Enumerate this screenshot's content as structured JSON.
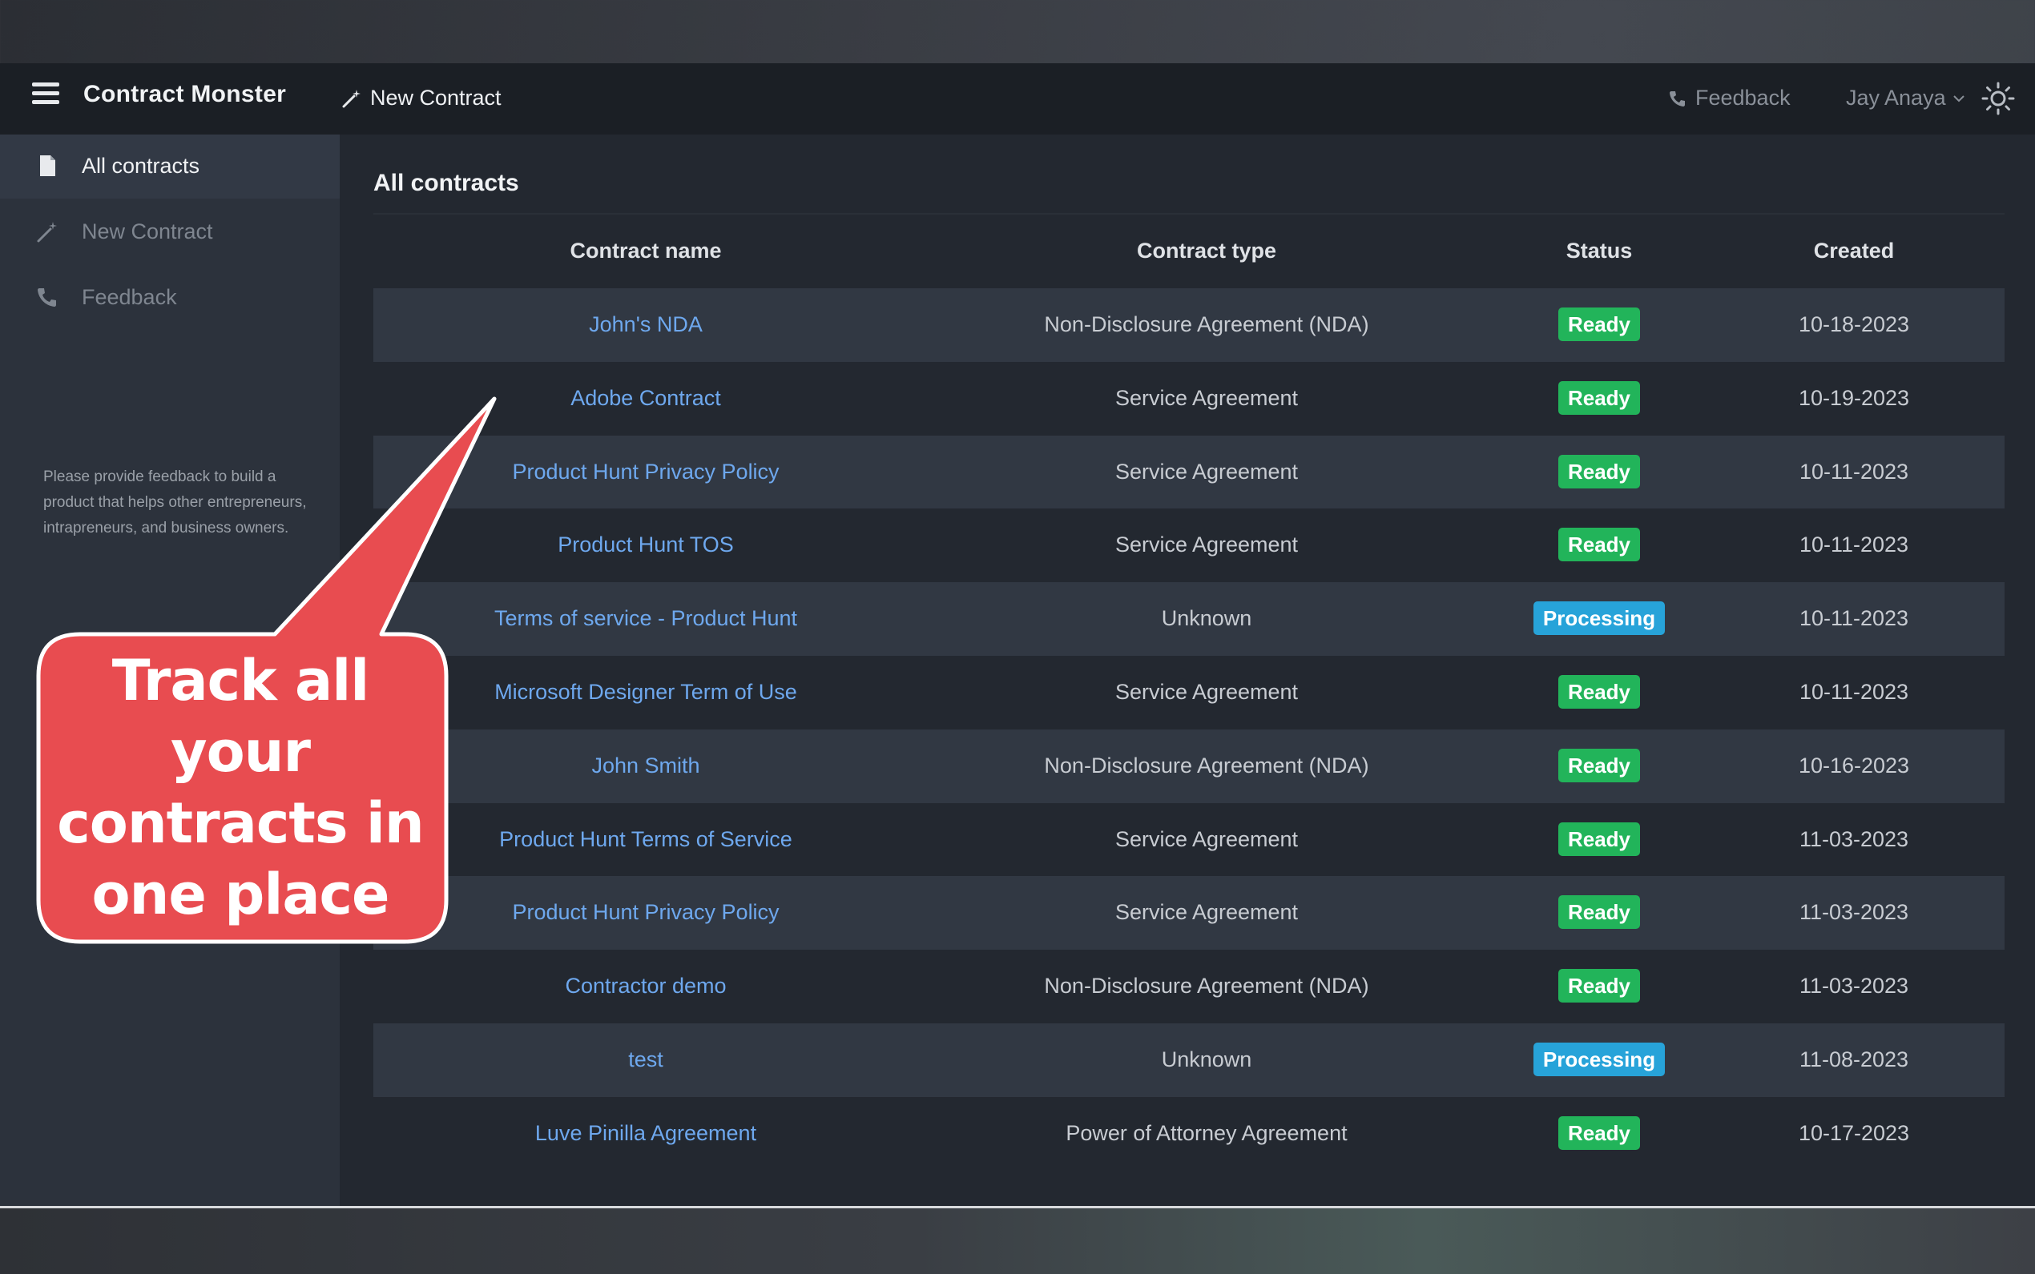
{
  "header": {
    "brand": "Contract Monster",
    "new_contract": "New Contract",
    "feedback": "Feedback",
    "user": "Jay Anaya"
  },
  "sidebar": {
    "items": [
      {
        "label": "All contracts",
        "icon": "document-icon",
        "active": true
      },
      {
        "label": "New Contract",
        "icon": "magic-wand-icon",
        "active": false
      },
      {
        "label": "Feedback",
        "icon": "phone-icon",
        "active": false
      }
    ],
    "note": "Please provide feedback to build a product that helps other entrepreneurs, intrapreneurs, and business owners."
  },
  "main": {
    "title": "All contracts",
    "columns": [
      "Contract name",
      "Contract type",
      "Status",
      "Created"
    ],
    "rows": [
      {
        "name": "John's NDA",
        "type": "Non-Disclosure Agreement (NDA)",
        "status": "Ready",
        "created": "10-18-2023"
      },
      {
        "name": "Adobe Contract",
        "type": "Service Agreement",
        "status": "Ready",
        "created": "10-19-2023"
      },
      {
        "name": "Product Hunt Privacy Policy",
        "type": "Service Agreement",
        "status": "Ready",
        "created": "10-11-2023"
      },
      {
        "name": "Product Hunt TOS",
        "type": "Service Agreement",
        "status": "Ready",
        "created": "10-11-2023"
      },
      {
        "name": "Terms of service - Product Hunt",
        "type": "Unknown",
        "status": "Processing",
        "created": "10-11-2023"
      },
      {
        "name": "Microsoft Designer Term of Use",
        "type": "Service Agreement",
        "status": "Ready",
        "created": "10-11-2023"
      },
      {
        "name": "John Smith",
        "type": "Non-Disclosure Agreement (NDA)",
        "status": "Ready",
        "created": "10-16-2023"
      },
      {
        "name": "Product Hunt Terms of Service",
        "type": "Service Agreement",
        "status": "Ready",
        "created": "11-03-2023"
      },
      {
        "name": "Product Hunt Privacy Policy",
        "type": "Service Agreement",
        "status": "Ready",
        "created": "11-03-2023"
      },
      {
        "name": "Contractor demo",
        "type": "Non-Disclosure Agreement (NDA)",
        "status": "Ready",
        "created": "11-03-2023"
      },
      {
        "name": "test",
        "type": "Unknown",
        "status": "Processing",
        "created": "11-08-2023"
      },
      {
        "name": "Luve Pinilla Agreement",
        "type": "Power of Attorney Agreement",
        "status": "Ready",
        "created": "10-17-2023"
      }
    ]
  },
  "callout": {
    "lines": [
      "Track all",
      "your",
      "contracts in",
      "one place"
    ]
  },
  "colors": {
    "ready": "#22b45a",
    "processing": "#27a3d9",
    "link": "#6ea8ee",
    "callout_fill": "#e84c50"
  }
}
